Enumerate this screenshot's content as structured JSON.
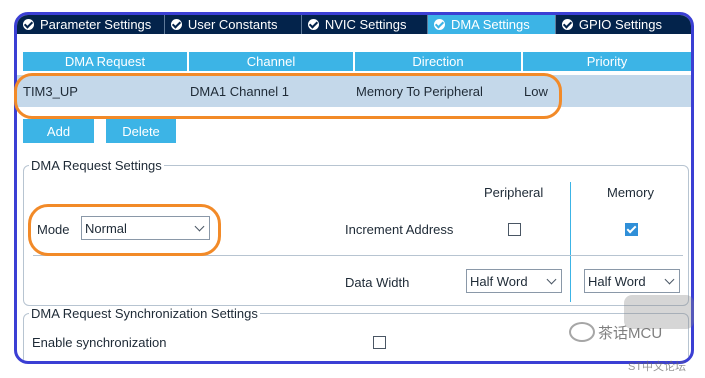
{
  "tabs": [
    {
      "label": "Parameter Settings",
      "active": false
    },
    {
      "label": "User Constants",
      "active": false
    },
    {
      "label": "NVIC Settings",
      "active": false
    },
    {
      "label": "DMA Settings",
      "active": true
    },
    {
      "label": "GPIO Settings",
      "active": false
    }
  ],
  "table": {
    "headers": [
      "DMA Request",
      "Channel",
      "Direction",
      "Priority"
    ],
    "rows": [
      [
        "TIM3_UP",
        "DMA1 Channel 1",
        "Memory To Peripheral",
        "Low"
      ]
    ]
  },
  "buttons": {
    "add": "Add",
    "delete": "Delete"
  },
  "request_settings": {
    "legend": "DMA Request Settings",
    "peripheral_header": "Peripheral",
    "memory_header": "Memory",
    "mode_label": "Mode",
    "mode_value": "Normal",
    "increment_label": "Increment Address",
    "increment_peripheral": false,
    "increment_memory": true,
    "data_width_label": "Data Width",
    "data_width_peripheral": "Half Word",
    "data_width_memory": "Half Word"
  },
  "sync_settings": {
    "legend": "DMA Request Synchronization Settings",
    "enable_label": "Enable synchronization",
    "enable_checked": false
  },
  "watermark": {
    "text1": "茶话MCU",
    "text2": "ST中文论坛"
  },
  "colors": {
    "tab_bar": "#03234b",
    "accent": "#3cb4e6",
    "selected_row": "#c4d8ea",
    "annotation": "#f28a28",
    "frame": "#3b3fd4"
  }
}
